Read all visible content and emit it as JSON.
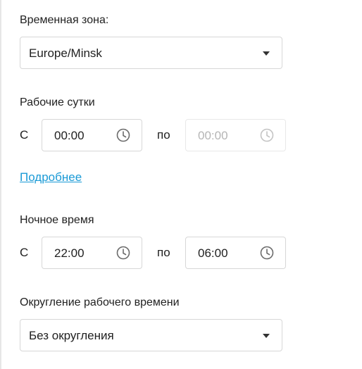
{
  "timezone": {
    "label": "Временная зона:",
    "value": "Europe/Minsk"
  },
  "work_day": {
    "label": "Рабочие сутки",
    "from_prefix": "С",
    "from_value": "00:00",
    "to_prefix": "по",
    "to_value": "00:00"
  },
  "more_link": "Подробнее",
  "night_time": {
    "label": "Ночное время",
    "from_prefix": "С",
    "from_value": "22:00",
    "to_prefix": "по",
    "to_value": "06:00"
  },
  "rounding": {
    "label": "Округление рабочего времени",
    "value": "Без округления"
  },
  "icons": {
    "dropdown": "caret-down-icon",
    "time": "clock-icon"
  }
}
